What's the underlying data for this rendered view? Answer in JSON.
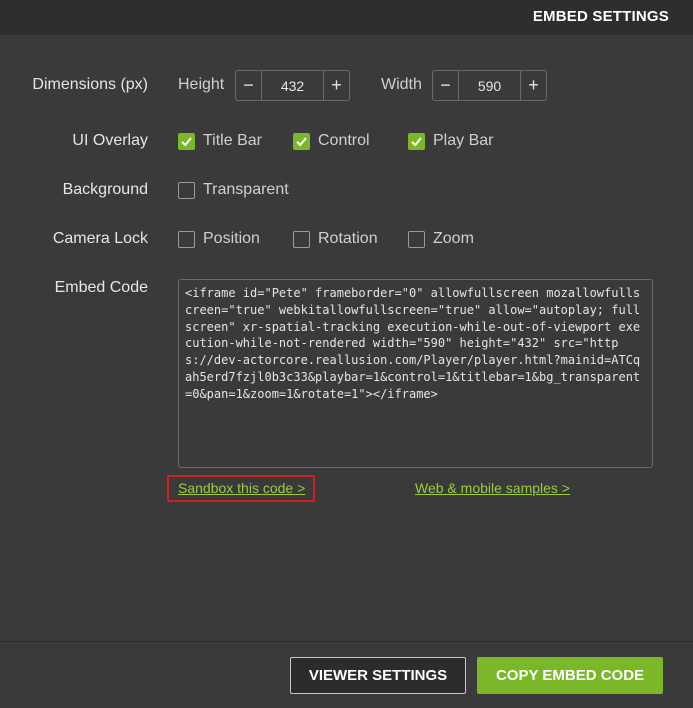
{
  "header": {
    "title": "EMBED SETTINGS"
  },
  "dimensions": {
    "label": "Dimensions (px)",
    "height_label": "Height",
    "height_value": "432",
    "width_label": "Width",
    "width_value": "590",
    "minus": "−",
    "plus": "+"
  },
  "ui_overlay": {
    "label": "UI Overlay",
    "title_bar": "Title Bar",
    "control": "Control",
    "play_bar": "Play Bar"
  },
  "background": {
    "label": "Background",
    "transparent": "Transparent"
  },
  "camera_lock": {
    "label": "Camera Lock",
    "position": "Position",
    "rotation": "Rotation",
    "zoom": "Zoom"
  },
  "embed_code": {
    "label": "Embed Code",
    "code": "<iframe id=\"Pete\" frameborder=\"0\" allowfullscreen mozallowfullscreen=\"true\" webkitallowfullscreen=\"true\" allow=\"autoplay; fullscreen\" xr-spatial-tracking execution-while-out-of-viewport execution-while-not-rendered width=\"590\" height=\"432\" src=\"https://dev-actorcore.reallusion.com/Player/player.html?mainid=ATCqah5erd7fzjl0b3c33&playbar=1&control=1&titlebar=1&bg_transparent=0&pan=1&zoom=1&rotate=1\"></iframe>"
  },
  "links": {
    "sandbox": "Sandbox this code >",
    "samples": "Web & mobile samples >"
  },
  "footer": {
    "viewer_settings": "VIEWER SETTINGS",
    "copy_embed_code": "COPY EMBED CODE"
  },
  "colors": {
    "accent": "#7ab829",
    "link": "#9ccc3f",
    "highlight": "#d02020",
    "background": "#3a3a3a",
    "header": "#2e2e2e"
  }
}
